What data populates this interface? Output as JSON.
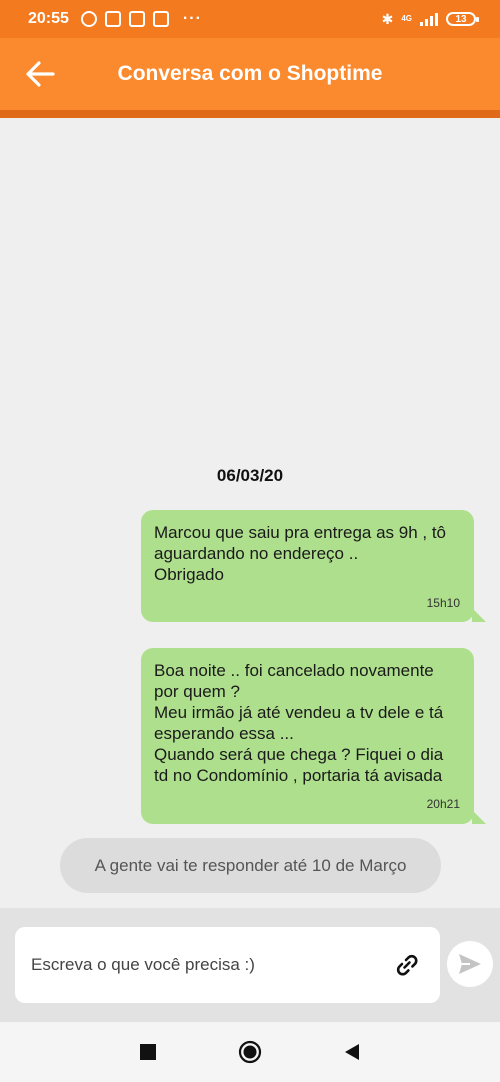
{
  "status_bar": {
    "time": "20:55",
    "network": "4G",
    "battery": "13",
    "overflow": "···"
  },
  "header": {
    "title": "Conversa com o Shoptime"
  },
  "chat": {
    "date": "06/03/20",
    "messages": [
      {
        "text": "Marcou que saiu pra entrega as 9h , tô\naguardando no endereço ..\nObrigado",
        "time": "15h10"
      },
      {
        "text": "Boa noite .. foi cancelado novamente\npor quem ?\nMeu irmão já até vendeu a tv dele e tá\nesperando essa ...\nQuando será que chega ? Fiquei o dia\ntd no Condomínio , portaria tá avisada",
        "time": "20h21"
      }
    ],
    "system_note": "A gente vai te responder até 10 de Março"
  },
  "composer": {
    "placeholder": "Escreva o que você precisa :)"
  },
  "colors": {
    "header": "#fb8a2e",
    "status_bar": "#f37a1f",
    "bubble": "#aedf8c"
  }
}
